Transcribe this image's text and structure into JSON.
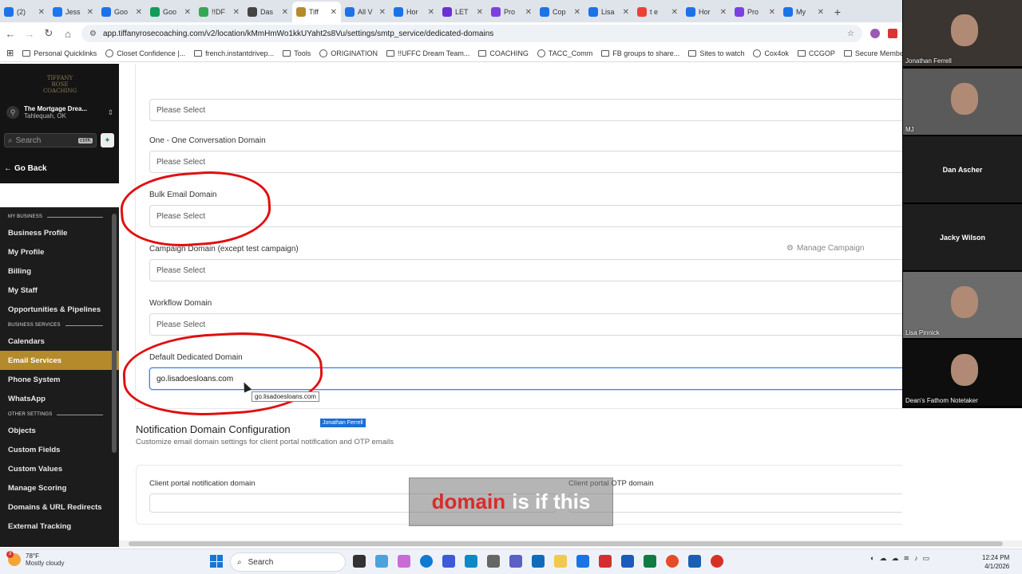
{
  "browser": {
    "tabs": [
      {
        "title": "(2)",
        "color": "#1a73e8"
      },
      {
        "title": "Jess",
        "color": "#1877f2"
      },
      {
        "title": "Goo",
        "color": "#1a73e8"
      },
      {
        "title": "Goo",
        "color": "#0f9d58"
      },
      {
        "title": "!!DF",
        "color": "#34a853"
      },
      {
        "title": "Das",
        "color": "#444444"
      },
      {
        "title": "Tiff",
        "color": "#b58a2b",
        "active": true
      },
      {
        "title": "All V",
        "color": "#1a73e8"
      },
      {
        "title": "Hor",
        "color": "#1a73e8"
      },
      {
        "title": "LET",
        "color": "#6b2fd6"
      },
      {
        "title": "Pro",
        "color": "#7b3fe4"
      },
      {
        "title": "Cop",
        "color": "#1a73e8"
      },
      {
        "title": "Lisa",
        "color": "#1a73e8"
      },
      {
        "title": "t e",
        "color": "#ea4335"
      },
      {
        "title": "Hor",
        "color": "#1a73e8"
      },
      {
        "title": "Pro",
        "color": "#7b3fe4"
      },
      {
        "title": "My",
        "color": "#1a73e8"
      }
    ],
    "url": "app.tiffanyrosecoaching.com/v2/location/kMmHmWo1kkUYaht2s8Vu/settings/smtp_service/dedicated-domains",
    "bookmarks": [
      "Personal Quicklinks",
      "Closet Confidence |...",
      "french.instantdrivep...",
      "Tools",
      "ORIGINATION",
      "!!UFFC Dream Team...",
      "COACHING",
      "TACC_Comm",
      "FB groups to share...",
      "Sites to watch",
      "Cox4ok",
      "CCGOP",
      "Secure Member Log..."
    ]
  },
  "sidebar": {
    "logo_text": "TIFFANY ROSE COACHING",
    "location_name": "The Mortgage Drea...",
    "location_city": "Tahlequah, OK",
    "search_placeholder": "Search",
    "search_shortcut": "ctrlK",
    "go_back": "Go Back",
    "sections": [
      {
        "title": "MY BUSINESS",
        "items": [
          "Business Profile",
          "My Profile",
          "Billing",
          "My Staff",
          "Opportunities & Pipelines"
        ]
      },
      {
        "title": "BUSINESS SERVICES",
        "items": [
          "Calendars",
          "Email Services",
          "Phone System",
          "WhatsApp"
        ]
      },
      {
        "title": "OTHER SETTINGS",
        "items": [
          "Objects",
          "Custom Fields",
          "Custom Values",
          "Manage Scoring",
          "Domains & URL Redirects",
          "External Tracking"
        ]
      }
    ],
    "active_item": "Email Services"
  },
  "main": {
    "fields": [
      {
        "label": "",
        "value": "Please Select"
      },
      {
        "label": "One - One Conversation Domain",
        "value": "Please Select"
      },
      {
        "label": "Bulk Email Domain",
        "value": "Please Select"
      },
      {
        "label": "Campaign Domain (except test campaign)",
        "value": "Please Select"
      },
      {
        "label": "Workflow Domain",
        "value": "Please Select"
      },
      {
        "label": "Default Dedicated Domain",
        "value": "go.lisadoesloans.com"
      }
    ],
    "manage_campaign": "Manage Campaign",
    "tooltip": "go.lisadoesloans.com",
    "pointer_name_chip": "Jonathan Ferrell",
    "notification": {
      "title": "Notification Domain Configuration",
      "subtitle": "Customize email domain settings for client portal notification and OTP emails",
      "portal_label": "Client portal notification domain",
      "otp_label": "Client portal OTP domain"
    },
    "caption": {
      "highlight": "domain",
      "rest": "is if this"
    }
  },
  "participants": [
    {
      "name": "Jonathan Ferrell",
      "video": true
    },
    {
      "name": "MJ",
      "video": true
    },
    {
      "name": "Dan Ascher",
      "video": false
    },
    {
      "name": "Jacky Wilson",
      "video": false
    },
    {
      "name": "Lisa Pinnick",
      "video": true
    },
    {
      "name": "Dean's Fathom Notetaker",
      "video": true
    }
  ],
  "taskbar": {
    "weather_temp": "78°F",
    "weather_desc": "Mostly cloudy",
    "weather_badge": "3",
    "search": "Search",
    "time": "12:24 PM",
    "date": "4/1/2026"
  }
}
